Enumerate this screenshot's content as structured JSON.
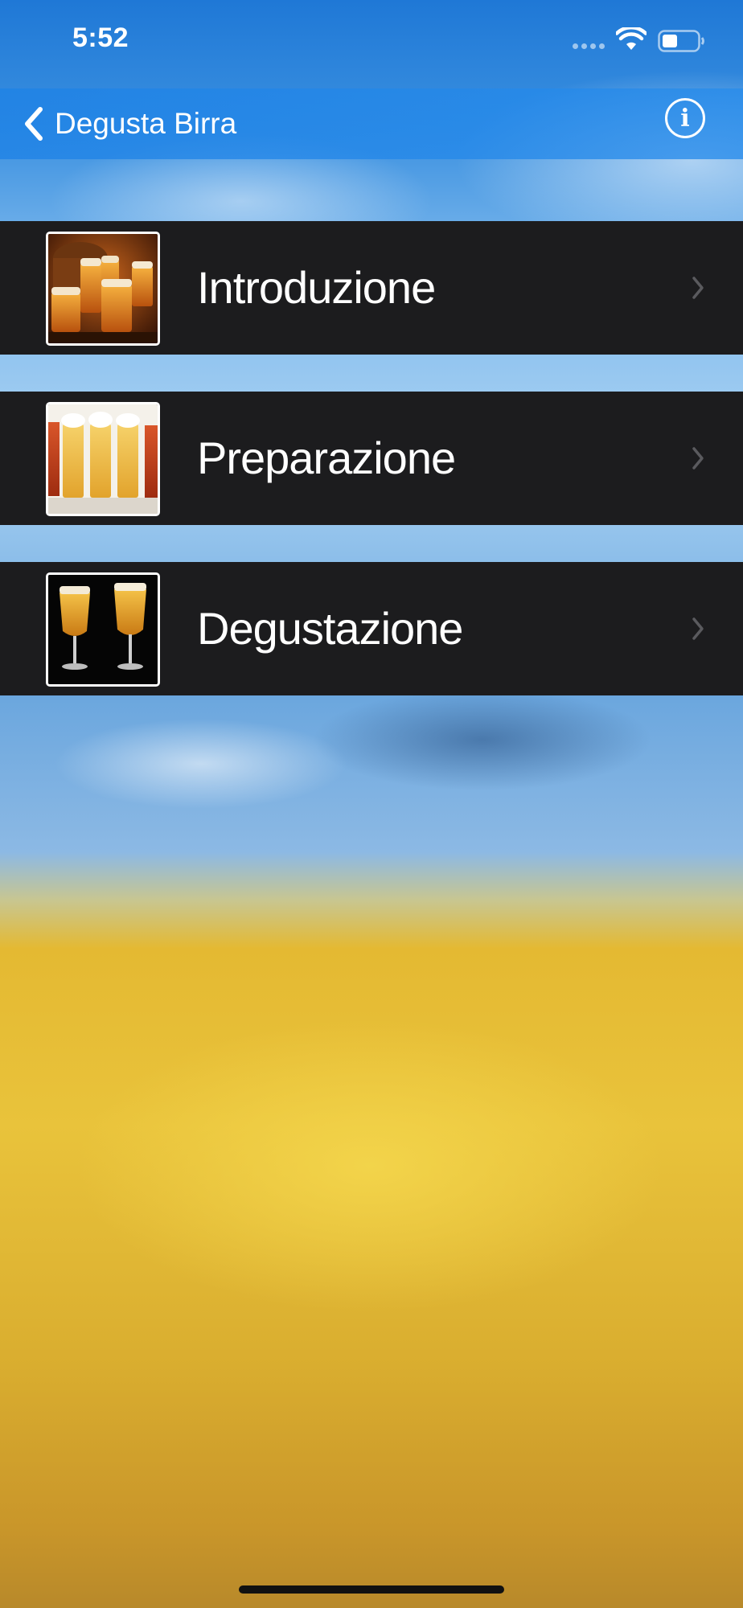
{
  "status_bar": {
    "time": "5:52",
    "icons": [
      "signal-dots-icon",
      "wifi-icon",
      "battery-icon"
    ]
  },
  "nav_bar": {
    "back_label": "Degusta Birra",
    "back_icon": "chevron-left-icon",
    "info_icon": "info-icon",
    "info_letter": "i"
  },
  "menu": {
    "items": [
      {
        "label": "Introduzione",
        "thumbnail": "beer-glasses-and-barrel-photo",
        "chevron": "chevron-right-icon"
      },
      {
        "label": "Preparazione",
        "thumbnail": "row-of-beer-glasses-photo",
        "chevron": "chevron-right-icon"
      },
      {
        "label": "Degustazione",
        "thumbnail": "two-stemmed-beer-glasses-photo",
        "chevron": "chevron-right-icon"
      }
    ]
  },
  "colors": {
    "nav_accent": "#1e82e6",
    "row_background": "#1c1c1e",
    "text": "#ffffff",
    "chevron": "#5a5a5e"
  }
}
